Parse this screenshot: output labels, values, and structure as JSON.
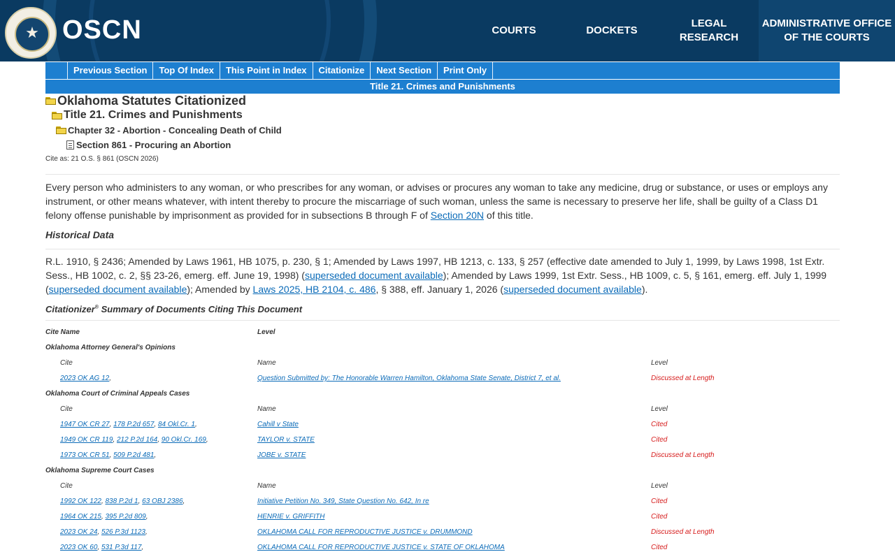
{
  "header": {
    "logo": "OSCN",
    "seal_text": "THE SUPREME COURT OF THE STATE OF OKLAHOMA 1907",
    "nav": {
      "courts": "COURTS",
      "dockets": "DOCKETS",
      "legal_research_1": "LEGAL",
      "legal_research_2": "RESEARCH",
      "admin_1": "ADMINISTRATIVE OFFICE",
      "admin_2": "OF THE COURTS"
    }
  },
  "toolbar": {
    "previous_section": "Previous Section",
    "top_of_index": "Top Of Index",
    "this_point_in_index": "This Point in Index",
    "citationize": "Citationize",
    "next_section": "Next Section",
    "print_only": "Print Only"
  },
  "title_bar": "Title 21. Crimes and Punishments",
  "tree": {
    "root": "Oklahoma Statutes Citationized",
    "title": "Title 21. Crimes and Punishments",
    "chapter": "Chapter 32 - Abortion - Concealing Death of Child",
    "section": "Section 861 - Procuring an Abortion"
  },
  "cite_as": "Cite as: 21 O.S. § 861 (OSCN 2026)",
  "statute": {
    "text_before": "Every person who administers to any woman, or who prescribes for any woman, or advises or procures any woman to take any medicine, drug or substance, or uses or employs any instrument, or other means whatever, with intent thereby to procure the miscarriage of such woman, unless the same is necessary to preserve her life, shall be guilty of a Class D1 felony offense punishable by imprisonment as provided for in subsections B through F of ",
    "link": "Section 20N",
    "text_after": " of this title."
  },
  "historical": {
    "heading": "Historical Data",
    "t1": "R.L. 1910, § 2436; Amended by Laws 1961, HB 1075, p. 230, § 1; Amended by Laws 1997, HB 1213, c. 133, § 257 (effective date amended to July 1, 1999, by Laws 1998, 1st Extr. Sess., HB 1002, c. 2, §§ 23-26, emerg. eff. June 19, 1998) (",
    "l1": "superseded document available",
    "t2": "); Amended by Laws 1999, 1st Extr. Sess., HB 1009, c. 5, § 161, emerg. eff. July 1, 1999 (",
    "l2": "superseded document available",
    "t3": "); Amended by ",
    "l3": "Laws 2025, HB 2104, c. 486",
    "t4": ", § 388, eff. January 1, 2026 (",
    "l4": "superseded document available",
    "t5": ")."
  },
  "citationizer": {
    "heading_main": "Citationizer",
    "heading_sup": "®",
    "heading_rest": " Summary of Documents Citing This Document",
    "col_cite_name": "Cite Name",
    "col_level": "Level",
    "sub_cite": "Cite",
    "sub_name": "Name",
    "sub_level": "Level",
    "groups": {
      "ag": {
        "name": "Oklahoma Attorney General's Opinions",
        "rows": [
          {
            "cite": "2023 OK AG 12",
            "name": "Question Submitted by: The Honorable Warren Hamilton, Oklahoma State Senate, District 7, et al.",
            "level": "Discussed at Length"
          }
        ]
      },
      "cca": {
        "name": "Oklahoma Court of Criminal Appeals Cases",
        "rows": [
          {
            "c1": "1947 OK CR 27",
            "c2": "178 P.2d 657",
            "c3": "84 Okl.Cr. 1",
            "name": "Cahill v State",
            "level": "Cited"
          },
          {
            "c1": "1949 OK CR 119",
            "c2": "212 P.2d 164",
            "c3": "90 Okl.Cr. 169",
            "name": "TAYLOR v. STATE",
            "level": "Cited"
          },
          {
            "c1": "1973 OK CR 51",
            "c2": "509 P.2d 481",
            "name": "JOBE v. STATE",
            "level": "Discussed at Length"
          }
        ]
      },
      "sc": {
        "name": "Oklahoma Supreme Court Cases",
        "rows": [
          {
            "c1": "1992 OK 122",
            "c2": "838 P.2d 1",
            "c3": "63 OBJ 2386",
            "name": "Initiative Petition No. 349, State Question No. 642, In re",
            "level": "Cited"
          },
          {
            "c1": "1964 OK 215",
            "c2": "395 P.2d 809",
            "name": "HENRIE v. GRIFFITH",
            "level": "Cited"
          },
          {
            "c1": "2023 OK 24",
            "c2": "526 P.3d 1123",
            "name": "OKLAHOMA CALL FOR REPRODUCTIVE JUSTICE v. DRUMMOND",
            "level": "Discussed at Length"
          },
          {
            "c1": "2023 OK 60",
            "c2": "531 P.3d 117",
            "name": "OKLAHOMA CALL FOR REPRODUCTIVE JUSTICE v. STATE OF OKLAHOMA",
            "level": "Cited"
          }
        ]
      }
    }
  }
}
